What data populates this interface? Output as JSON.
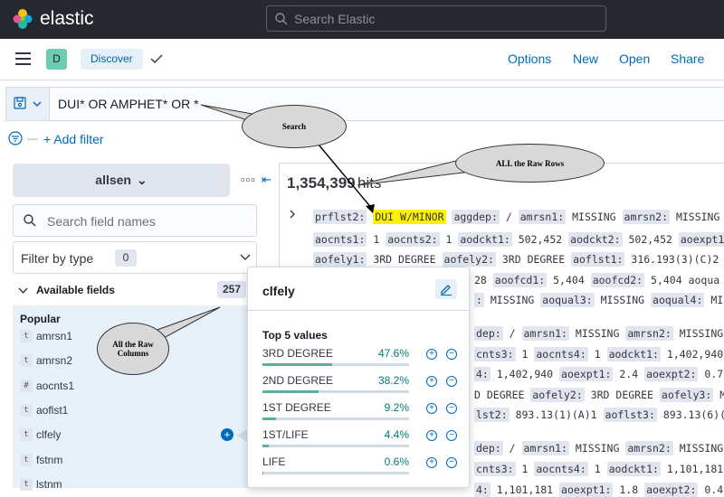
{
  "app": {
    "name": "elastic"
  },
  "global_search": {
    "placeholder": "Search Elastic"
  },
  "nav": {
    "space_initial": "D",
    "breadcrumb": "Discover",
    "links": [
      "Options",
      "New",
      "Open",
      "Share"
    ]
  },
  "query": {
    "text": "DUI* OR AMPHET* OR *"
  },
  "filter": {
    "add_label": "+ Add filter"
  },
  "sidebar": {
    "index_pattern": "allsen",
    "search_placeholder": "Search field names",
    "filter_by_type": "Filter by type",
    "filter_count": "0",
    "available_fields_label": "Available fields",
    "available_fields_count": "257",
    "popular_label": "Popular",
    "fields": [
      {
        "type": "t",
        "name": "amrsn1"
      },
      {
        "type": "t",
        "name": "amrsn2"
      },
      {
        "type": "#",
        "name": "aocnts1"
      },
      {
        "type": "t",
        "name": "aoflst1"
      },
      {
        "type": "t",
        "name": "clfely"
      },
      {
        "type": "t",
        "name": "fstnm"
      },
      {
        "type": "t",
        "name": "lstnm"
      }
    ]
  },
  "hits": {
    "count": "1,354,399",
    "label": "hits",
    "rows": [
      "prflst2: DUI W/MINOR aggdep: / amrsn1: MISSING amrsn2: MISSING a",
      "aocnts1: 1 aocnts2: 1 aodckt1: 502,452 aodckt2: 502,452 aoexpt1:",
      "aofely1: 3RD DEGREE aofely2: 3RD DEGREE aoflst1: 316.193(3)(C)2 a",
      "28 aoofcd1: 5,404 aoofcd2: 5,404 aoqua",
      ": MISSING aoqual3: MISSING aoqual4: MISS",
      "dep: / amrsn1: MISSING amrsn2: MISSING a",
      "cnts3: 1 aocnts4: 1 aodckt1: 1,402,940 a",
      "4: 1,402,940 aoexpt1: 2.4 aoexpt2: 0.7",
      "D DEGREE aofely2: 3RD DEGREE aofely3: MIS",
      "lst2: 893.13(1)(A)1 aoflst3: 893.13(6)(B)",
      "dep: / amrsn1: MISSING amrsn2: MISSING a",
      "cnts3: 1 aocnts4: 1 aodckt1: 1,101,181 a",
      "4: 1,101,181 aoexpt1: 1.8 aoexpt2: 0.4"
    ],
    "highlight": "DUI W/MINOR"
  },
  "popover": {
    "field": "clfely",
    "top_values_label": "Top 5 values",
    "values": [
      {
        "label": "3RD DEGREE",
        "percent": "47.6%",
        "fraction": 0.476
      },
      {
        "label": "2ND DEGREE",
        "percent": "38.2%",
        "fraction": 0.382
      },
      {
        "label": "1ST DEGREE",
        "percent": "9.2%",
        "fraction": 0.092
      },
      {
        "label": "1ST/LIFE",
        "percent": "4.4%",
        "fraction": 0.044
      },
      {
        "label": "LIFE",
        "percent": "0.6%",
        "fraction": 0.006
      }
    ]
  },
  "annotations": {
    "search": "Search",
    "raw_rows": "ALL the Raw Rows",
    "raw_columns": "All the Raw Columns"
  },
  "colors": {
    "accent": "#006bb8",
    "highlight": "#fff200",
    "bar": "#54b399"
  }
}
